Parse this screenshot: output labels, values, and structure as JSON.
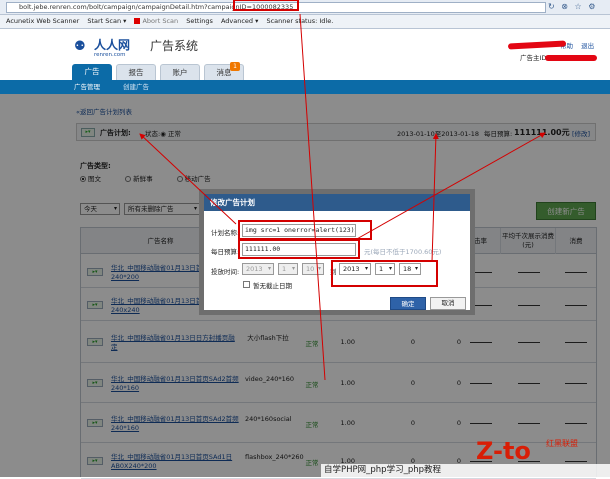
{
  "browser": {
    "url": "bolt.jebe.renren.com/bolt/campaign/campaignDetail.htm?campaignID=1000082335",
    "icons": "↻ ⊗ ☆ ⚙",
    "toolbar": {
      "scanner": "Acunetix Web Scanner",
      "start": "Start Scan ▾",
      "abort": "Abort Scan",
      "settings": "Settings",
      "advanced": "Advanced ▾",
      "status": "Scanner status: Idle."
    }
  },
  "header": {
    "logo_text": "人人网",
    "logo_sub": "renren.com",
    "title": "广告系统",
    "help": "帮助",
    "logout": "退出",
    "owner_label": "广告主ID:"
  },
  "tabs": [
    {
      "label": "广告"
    },
    {
      "label": "报告"
    },
    {
      "label": "账户"
    },
    {
      "label": "消息"
    }
  ],
  "tab_badge": "1",
  "subnav": {
    "manage": "广告管理",
    "create": "创建广告"
  },
  "page": {
    "back_link": "«返回广告计划列表",
    "plan_label": "广告计划:",
    "plan_status": "状态:◉ 正常",
    "plan_dates": "2013-01-10至2013-01-18",
    "budget_label": "每日预算:",
    "budget_value": "111111.00元",
    "edit_link": "[修改]",
    "type_label": "广告类型:",
    "type_options": [
      "图文",
      "新鲜事",
      "移动广告"
    ],
    "filter_period": "今天",
    "filter_status": "所有未删除广告",
    "new_button": "创建新广告"
  },
  "table": {
    "headers": [
      "广告名称",
      "击率",
      "平均千次展示消费(元)",
      "消费"
    ],
    "rows": [
      {
        "name": "华北_中国移动融省01月13日首页SAd1首频240*200",
        "size": "",
        "status": "",
        "bid": "",
        "c1": "",
        "c2": ""
      },
      {
        "name": "华北_中国移动融省01月13日首页SAd1首频240x240",
        "size": "",
        "status": "",
        "bid": "",
        "c1": "",
        "c2": ""
      },
      {
        "name": "华北_中国移动融省01月13日日方封播页融定",
        "size": "大小flash下拉",
        "status": "正常",
        "bid": "1.00",
        "c1": "0",
        "c2": "0"
      },
      {
        "name": "华北_中国移动融省01月13日首页SAd2首频240*160",
        "size": "video_240*160",
        "status": "正常",
        "bid": "1.00",
        "c1": "0",
        "c2": "0"
      },
      {
        "name": "华北_中国移动融省01月13日首页SAd2首频240*160",
        "size": "240*160social",
        "status": "正常",
        "bid": "1.00",
        "c1": "0",
        "c2": "0"
      },
      {
        "name": "华北_中国移动融省01月13日首页SAd1日AB0X240*200",
        "size": "flashbox_240*260",
        "status": "正常",
        "bid": "1.00",
        "c1": "0",
        "c2": "0"
      }
    ]
  },
  "modal": {
    "title": "修改广告计划",
    "name_label": "计划名称:",
    "name_value": "img src=1 onerror=alert(123)>",
    "budget_label": "每日预算:",
    "budget_value": "111111.00",
    "budget_hint": "元(每日不低于1700.60元)",
    "time_label": "投放时间:",
    "start_year": "2013",
    "start_month": "1",
    "start_day": "10",
    "to": "到",
    "end_year": "2013",
    "end_month": "1",
    "end_day": "18",
    "no_end": "暂无截止日期",
    "ok": "确定",
    "cancel": "取消"
  },
  "watermark": {
    "logo": "Z-to",
    "tag": "红黑联盟",
    "text": "自学PHP网_php学习_php教程"
  },
  "colors": {
    "brand": "#0c6ba7",
    "modal_head": "#2e5b8c",
    "highlight": "#d40000",
    "primary_btn": "#2e62a8"
  }
}
